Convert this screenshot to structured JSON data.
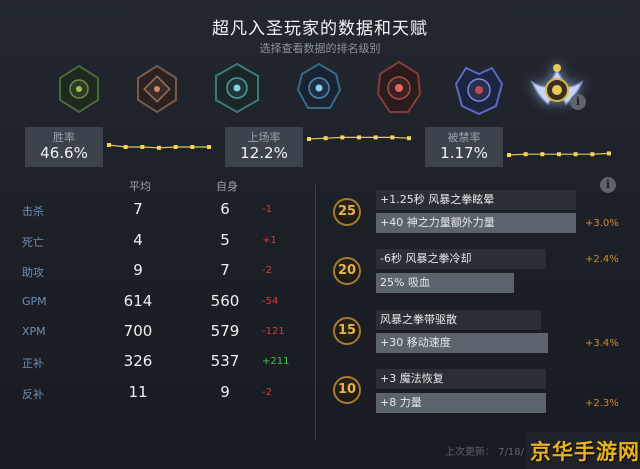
{
  "header": {
    "title": "超凡入圣玩家的数据和天赋",
    "subtitle": "选择查看数据的排名级别"
  },
  "ranks": [
    {
      "name": "herald-rank-icon",
      "color": "#4a7a3a"
    },
    {
      "name": "guardian-rank-icon",
      "color": "#8a5a4a"
    },
    {
      "name": "crusader-rank-icon",
      "color": "#3a8a8a"
    },
    {
      "name": "archon-rank-icon",
      "color": "#3a6a8a"
    },
    {
      "name": "legend-rank-icon",
      "color": "#8a3a3a"
    },
    {
      "name": "ancient-rank-icon",
      "color": "#4a5aaa"
    },
    {
      "name": "divine-rank-icon",
      "color": "#c8b04a"
    }
  ],
  "stats": [
    {
      "label": "胜率",
      "value": "46.6%",
      "trend": [
        0.55,
        0.5,
        0.5,
        0.48,
        0.5,
        0.5,
        0.5
      ]
    },
    {
      "label": "上场率",
      "value": "12.2%",
      "trend": [
        0.7,
        0.72,
        0.74,
        0.74,
        0.74,
        0.74,
        0.72
      ]
    },
    {
      "label": "被禁率",
      "value": "1.17%",
      "trend": [
        0.3,
        0.32,
        0.32,
        0.32,
        0.32,
        0.32,
        0.34
      ]
    }
  ],
  "table": {
    "col_avg": "平均",
    "col_self": "自身",
    "rows": [
      {
        "label": "击杀",
        "avg": "7",
        "self": "6",
        "diff": "-1",
        "sign": "neg"
      },
      {
        "label": "死亡",
        "avg": "4",
        "self": "5",
        "diff": "+1",
        "sign": "neg"
      },
      {
        "label": "助攻",
        "avg": "9",
        "self": "7",
        "diff": "-2",
        "sign": "neg"
      },
      {
        "label": "GPM",
        "avg": "614",
        "self": "560",
        "diff": "-54",
        "sign": "neg"
      },
      {
        "label": "XPM",
        "avg": "700",
        "self": "579",
        "diff": "-121",
        "sign": "neg"
      },
      {
        "label": "正补",
        "avg": "326",
        "self": "537",
        "diff": "+211",
        "sign": "pos"
      },
      {
        "label": "反补",
        "avg": "11",
        "self": "9",
        "diff": "-2",
        "sign": "neg"
      }
    ]
  },
  "talents": [
    {
      "level": "25",
      "top": "+1.25秒 风暴之拳眩晕",
      "top_fill": 0.82,
      "bottom": "+40 神之力量额外力量",
      "bottom_fill": 0.95,
      "pct": "+3.0%"
    },
    {
      "level": "20",
      "top": "-6秒 风暴之拳冷却",
      "top_fill": 0.12,
      "bottom": "25% 吸血",
      "bottom_fill": 0.68,
      "pct": "+2.4%"
    },
    {
      "level": "15",
      "top": "风暴之拳带驱散",
      "top_fill": 0.82,
      "bottom": "+30 移动速度",
      "bottom_fill": 0.85,
      "pct": "+3.4%"
    },
    {
      "level": "10",
      "top": "+3 魔法恢复",
      "top_fill": 0.12,
      "bottom": "+8 力量",
      "bottom_fill": 0.84,
      "pct": "+2.3%"
    }
  ],
  "footer": {
    "updated": "上次更新： 7/18/"
  },
  "watermark": "京华手游网"
}
